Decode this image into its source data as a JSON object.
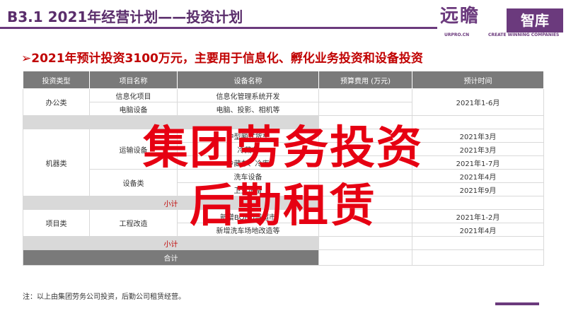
{
  "header": {
    "title": "B3.1  2021年经营计划——投资计划",
    "logo_cn": "远瞻",
    "logo_box": "智库",
    "logo_url": "URPRO.CN",
    "logo_tagline": "CREATE WINNING COMPANIES"
  },
  "subtitle": "➢2021年预计投资3100万元，主要用于信息化、孵化业务投资和设备投资",
  "table": {
    "headers": [
      "投资类型",
      "项目名称",
      "设备名称",
      "预算费用 (万元)",
      "预计时间"
    ],
    "office": {
      "type": "办公类",
      "rows": [
        {
          "project": "信息化项目",
          "equipment": "信息化管理系统开发"
        },
        {
          "project": "电脑设备",
          "equipment": "电脑、投影、相机等"
        }
      ],
      "time": "2021年1-6月"
    },
    "machinery": {
      "type": "机器类",
      "transport": {
        "name": "运输设备",
        "rows": [
          {
            "equipment": "中型厢式货车",
            "time": "2021年3月"
          },
          {
            "equipment": "冷藏车",
            "time": "2021年3月"
          },
          {
            "equipment": "冷藏车、冷库",
            "time": "2021年1-7月"
          }
        ]
      },
      "devices": {
        "name": "设备类",
        "rows": [
          {
            "equipment": "洗车设备",
            "time": "2021年4月"
          },
          {
            "equipment": "卫生设备",
            "time": "2021年9月"
          }
        ]
      },
      "subtotal": "小计"
    },
    "project": {
      "type": "项目类",
      "name": "工程改造",
      "rows": [
        {
          "equipment": "新增BOBO城超市",
          "time": "2021年1-2月"
        },
        {
          "equipment": "新增洗车场地改造等",
          "time": "2021年4月"
        }
      ],
      "subtotal": "小计"
    },
    "total": "合计"
  },
  "overlay": {
    "line1": "集团劳务投资",
    "line2": "后勤租赁"
  },
  "note": "注：以上由集团劳务公司投资，后勤公司租赁经营。"
}
